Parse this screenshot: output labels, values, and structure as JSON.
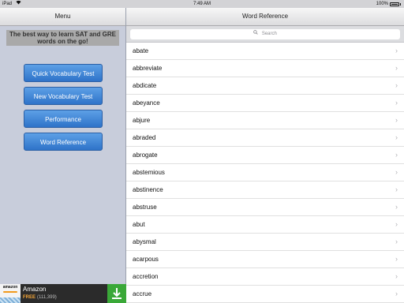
{
  "status_bar": {
    "device": "iPad",
    "wifi_icon": "wifi-icon",
    "time": "7:49 AM",
    "battery": "100%"
  },
  "left_pane": {
    "title": "Menu",
    "tagline": "The best way to learn SAT and GRE words on the go!",
    "buttons": [
      {
        "label": "Quick Vocabulary Test"
      },
      {
        "label": "New Vocabulary Test"
      },
      {
        "label": "Performance"
      },
      {
        "label": "Word Reference"
      }
    ],
    "accent_color": "#3a82d6"
  },
  "right_pane": {
    "title": "Word Reference",
    "search": {
      "placeholder": "Search",
      "icon": "search-icon"
    },
    "words": [
      "abate",
      "abbreviate",
      "abdicate",
      "abeyance",
      "abjure",
      "abraded",
      "abrogate",
      "abstemious",
      "abstinence",
      "abstruse",
      "abut",
      "abysmal",
      "acarpous",
      "accretion",
      "accrue"
    ],
    "row_icon": "chevron-right-icon"
  },
  "ad": {
    "logo_text": "amazon",
    "title": "Amazon",
    "price": "FREE",
    "count": "(111,399)",
    "download_icon": "download-icon",
    "download_color": "#3aa838"
  }
}
